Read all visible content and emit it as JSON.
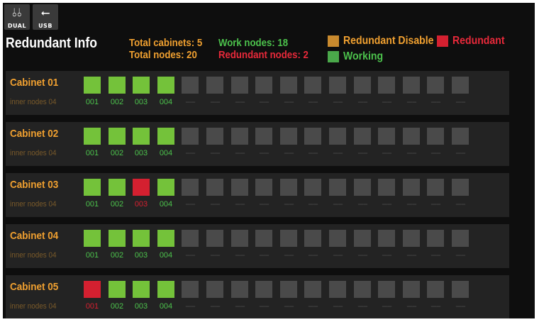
{
  "top_icons": [
    {
      "name": "dual-icon",
      "caption": "DUAL"
    },
    {
      "name": "usb-icon",
      "caption": "USB"
    }
  ],
  "page": {
    "title": "Redundant Info"
  },
  "stats": {
    "total_cabinets_label": "Total cabinets:",
    "total_cabinets": "5",
    "total_nodes_label": "Total nodes:",
    "total_nodes": "20",
    "work_nodes_label": "Work nodes:",
    "work_nodes": "18",
    "redundant_nodes_label": "Redundant nodes:",
    "redundant_nodes": "2"
  },
  "legend": [
    {
      "label": "Redundant Disable",
      "color": "#c98a2e"
    },
    {
      "label": "Redundant",
      "color": "#d42030"
    },
    {
      "label": "Working",
      "color": "#4aa84a"
    }
  ],
  "colors": {
    "working": "#74c23a",
    "redundant": "#d42030",
    "empty": "#4a4a4a",
    "accent": "#f0a030"
  },
  "cabinets": [
    {
      "name": "Cabinet 01",
      "inner": "inner nodes 04",
      "nodes": [
        {
          "label": "001",
          "state": "working"
        },
        {
          "label": "002",
          "state": "working"
        },
        {
          "label": "003",
          "state": "working"
        },
        {
          "label": "004",
          "state": "working"
        }
      ]
    },
    {
      "name": "Cabinet 02",
      "inner": "inner nodes 04",
      "nodes": [
        {
          "label": "001",
          "state": "working"
        },
        {
          "label": "002",
          "state": "working"
        },
        {
          "label": "003",
          "state": "working"
        },
        {
          "label": "004",
          "state": "working"
        }
      ]
    },
    {
      "name": "Cabinet 03",
      "inner": "inner nodes 04",
      "nodes": [
        {
          "label": "001",
          "state": "working"
        },
        {
          "label": "002",
          "state": "working"
        },
        {
          "label": "003",
          "state": "redundant"
        },
        {
          "label": "004",
          "state": "working"
        }
      ]
    },
    {
      "name": "Cabinet 04",
      "inner": "inner nodes 04",
      "nodes": [
        {
          "label": "001",
          "state": "working"
        },
        {
          "label": "002",
          "state": "working"
        },
        {
          "label": "003",
          "state": "working"
        },
        {
          "label": "004",
          "state": "working"
        }
      ]
    },
    {
      "name": "Cabinet 05",
      "inner": "inner nodes 04",
      "nodes": [
        {
          "label": "001",
          "state": "redundant"
        },
        {
          "label": "002",
          "state": "working"
        },
        {
          "label": "003",
          "state": "working"
        },
        {
          "label": "004",
          "state": "working"
        }
      ]
    }
  ],
  "empty_slot_label": "-----",
  "empty_slots_per_cabinet": 12
}
